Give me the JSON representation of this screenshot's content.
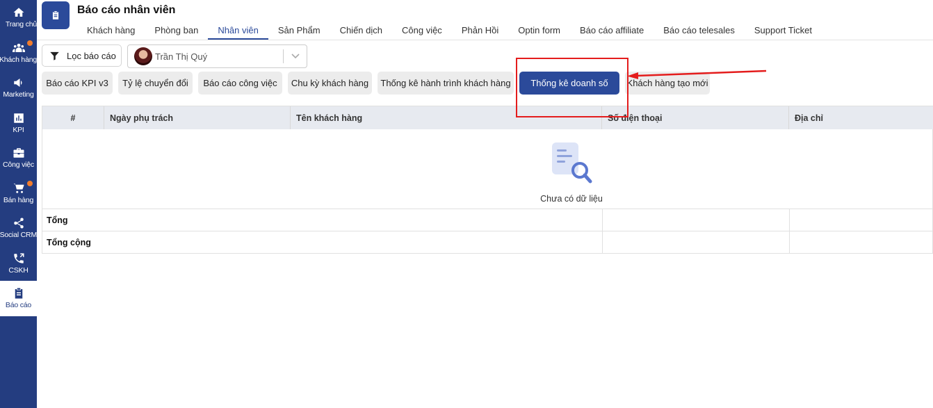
{
  "sidebar": {
    "items": [
      {
        "label": "Trang chủ",
        "icon": "home-icon",
        "badge": false
      },
      {
        "label": "Khách hàng",
        "icon": "users-icon",
        "badge": true
      },
      {
        "label": "Marketing",
        "icon": "megaphone-icon",
        "badge": false
      },
      {
        "label": "KPI",
        "icon": "chart-icon",
        "badge": false
      },
      {
        "label": "Công việc",
        "icon": "briefcase-icon",
        "badge": false
      },
      {
        "label": "Bán hàng",
        "icon": "cart-icon",
        "badge": true
      },
      {
        "label": "Social CRM",
        "icon": "share-icon",
        "badge": false
      },
      {
        "label": "CSKH",
        "icon": "phone-icon",
        "badge": false
      },
      {
        "label": "Báo cáo",
        "icon": "clipboard-icon",
        "badge": false,
        "active": true
      }
    ],
    "badge_color": "#f07c2c",
    "bg_color": "#243d80"
  },
  "header": {
    "title": "Báo cáo nhân viên",
    "tabs": [
      {
        "label": "Khách hàng"
      },
      {
        "label": "Phòng ban"
      },
      {
        "label": "Nhân viên",
        "active": true
      },
      {
        "label": "Sản Phẩm"
      },
      {
        "label": "Chiến dịch"
      },
      {
        "label": "Công việc"
      },
      {
        "label": "Phản Hồi"
      },
      {
        "label": "Optin form"
      },
      {
        "label": "Báo cáo affiliate"
      },
      {
        "label": "Báo cáo telesales"
      },
      {
        "label": "Support Ticket"
      }
    ]
  },
  "filters": {
    "filter_label": "Lọc báo cáo",
    "user_name": "Trần Thị Quý"
  },
  "report_types": [
    {
      "label": "Báo cáo KPI v3"
    },
    {
      "label": "Tỷ lệ chuyển đổi"
    },
    {
      "label": "Báo cáo công việc"
    },
    {
      "label": "Chu kỳ khách hàng"
    },
    {
      "label": "Thống kê hành trình khách hàng"
    },
    {
      "label": "Thống kê doanh số",
      "active": true
    },
    {
      "label": "Khách hàng tạo mới"
    }
  ],
  "table": {
    "columns": [
      "#",
      "Ngày phụ trách",
      "Tên khách hàng",
      "Số điện thoại",
      "Địa chỉ"
    ],
    "empty_text": "Chưa có dữ liệu",
    "summary_rows": [
      "Tổng",
      "Tổng cộng"
    ]
  },
  "colors": {
    "primary": "#2b4a9a",
    "annotation": "#e41c1c"
  }
}
